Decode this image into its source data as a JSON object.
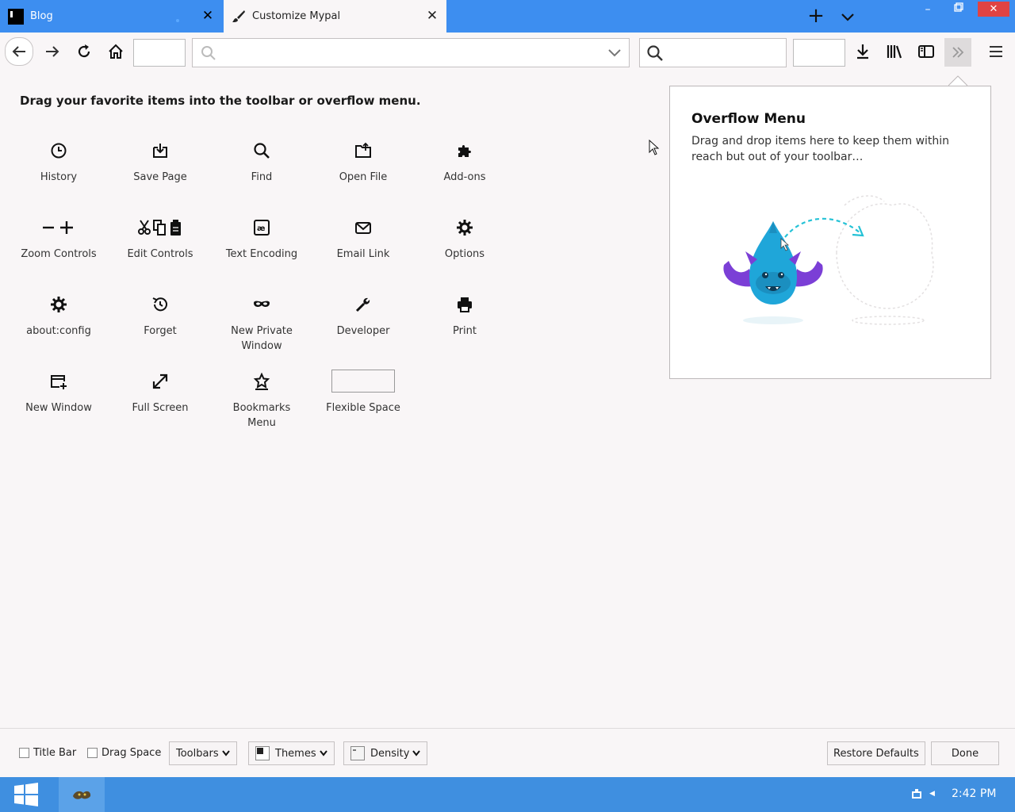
{
  "tabs": [
    {
      "label": "Blog",
      "icon": "black-square-favicon"
    },
    {
      "label": "Customize Mypal",
      "icon": "paintbrush-icon"
    }
  ],
  "palette": {
    "heading": "Drag your favorite items into the toolbar or overflow menu.",
    "items": [
      {
        "label": "History",
        "icon": "clock-icon"
      },
      {
        "label": "Save Page",
        "icon": "save-page-icon"
      },
      {
        "label": "Find",
        "icon": "magnifier-icon"
      },
      {
        "label": "Open File",
        "icon": "folder-open-icon"
      },
      {
        "label": "Add-ons",
        "icon": "puzzle-piece-icon"
      },
      {
        "label": "Zoom Controls",
        "icon": "zoom-minus-plus-icon"
      },
      {
        "label": "Edit Controls",
        "icon": "cut-copy-paste-icon"
      },
      {
        "label": "Text Encoding",
        "icon": "text-encoding-icon"
      },
      {
        "label": "Email Link",
        "icon": "envelope-icon"
      },
      {
        "label": "Options",
        "icon": "gear-icon"
      },
      {
        "label": "about:config",
        "icon": "gear-icon"
      },
      {
        "label": "Forget",
        "icon": "forget-history-icon"
      },
      {
        "label": "New Private Window",
        "icon": "mask-icon"
      },
      {
        "label": "Developer",
        "icon": "wrench-icon"
      },
      {
        "label": "Print",
        "icon": "printer-icon"
      },
      {
        "label": "New Window",
        "icon": "new-window-icon"
      },
      {
        "label": "Full Screen",
        "icon": "expand-arrows-icon"
      },
      {
        "label": "Bookmarks Menu",
        "icon": "bookmark-star-icon"
      },
      {
        "label": "Flexible Space",
        "icon": "flexible-space-box"
      }
    ]
  },
  "overflow_panel": {
    "title": "Overflow Menu",
    "description": "Drag and drop items here to keep them within reach but out of your toolbar…"
  },
  "footer": {
    "title_bar_label": "Title Bar",
    "drag_space_label": "Drag Space",
    "toolbars_label": "Toolbars",
    "themes_label": "Themes",
    "density_label": "Density",
    "restore_defaults_label": "Restore Defaults",
    "done_label": "Done"
  },
  "taskbar": {
    "clock": "2:42 PM"
  },
  "colors": {
    "tabstrip": "#3d8ef0",
    "page_background": "#f9f6f7",
    "taskbar": "#3f8fe0",
    "close_button": "#e04343",
    "mascot_body": "#1fa6d9",
    "mascot_wings": "#7b3fd6"
  }
}
